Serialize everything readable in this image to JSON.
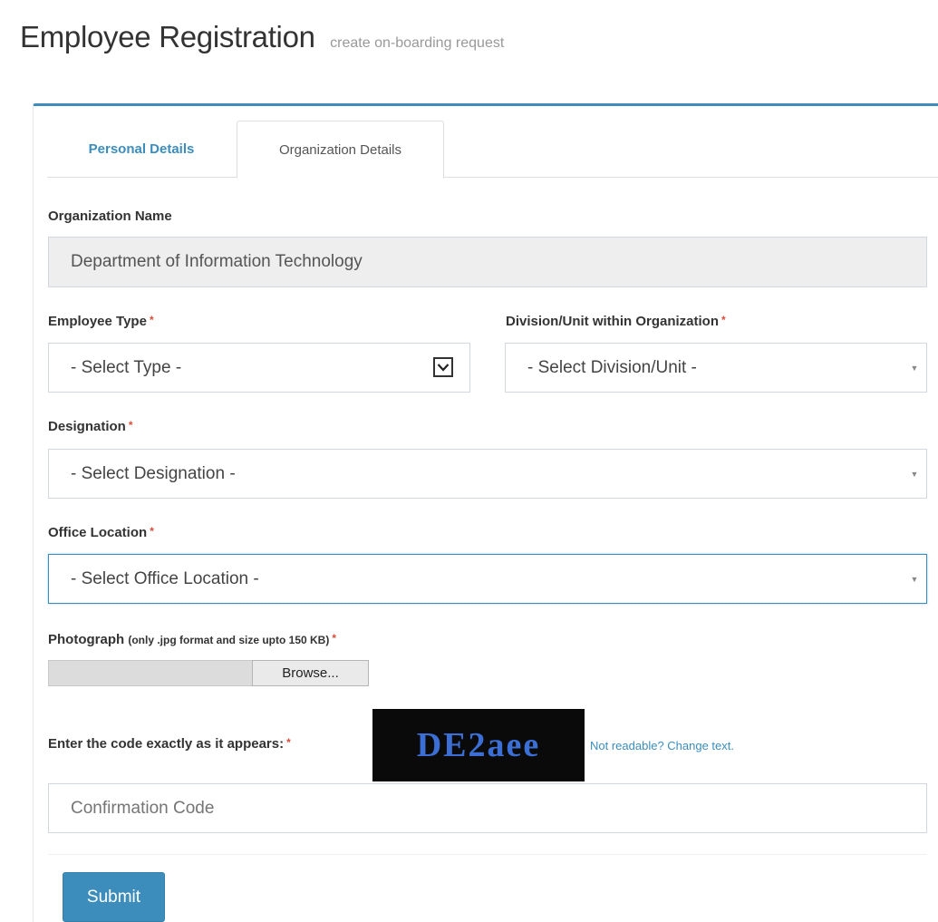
{
  "header": {
    "title": "Employee Registration",
    "subtitle": "create on-boarding request"
  },
  "tabs": [
    {
      "label": "Personal Details",
      "active": false
    },
    {
      "label": "Organization Details",
      "active": true
    }
  ],
  "form": {
    "organization_name": {
      "label": "Organization Name",
      "value": "Department of Information Technology"
    },
    "employee_type": {
      "label": "Employee Type",
      "required": "*",
      "selected": "- Select Type -"
    },
    "division": {
      "label": "Division/Unit within Organization",
      "required": "*",
      "selected": "- Select Division/Unit -"
    },
    "designation": {
      "label": "Designation",
      "required": "*",
      "selected": "- Select Designation -"
    },
    "office_location": {
      "label": "Office Location",
      "required": "*",
      "selected": "- Select Office Location -"
    },
    "photograph": {
      "label": "Photograph",
      "hint": "(only .jpg format and size upto 150 KB)",
      "required": "*",
      "browse_label": "Browse..."
    },
    "captcha": {
      "label": "Enter the code exactly as it appears:",
      "required": "*",
      "code": "DE2aee",
      "change_link": "Not readable? Change text.",
      "placeholder": "Confirmation Code"
    },
    "submit_label": "Submit"
  },
  "colors": {
    "accent": "#3c8dbc",
    "required": "#dd4b39",
    "captcha_bg": "#0a0a0a",
    "captcha_text": "#3b6fd6"
  }
}
